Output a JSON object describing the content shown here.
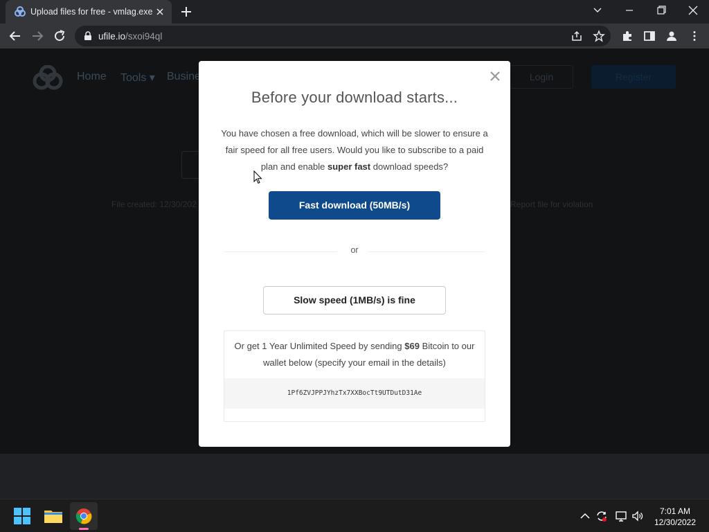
{
  "browser": {
    "tab_title": "Upload files for free - vmlag.exe",
    "url_host": "ufile.io",
    "url_path": "/sxoi94ql"
  },
  "page_bg": {
    "nav": [
      "Home",
      "Tools",
      "Busine"
    ],
    "login": "Login",
    "register": "Register",
    "file_created": "File created: 12/30/202",
    "report": "Report file for violation"
  },
  "modal": {
    "title": "Before your download starts...",
    "text_part1": "You have chosen a free download, which will be slower to ensure a fair speed for all free users. Would you like to subscribe to a paid plan and enable ",
    "text_bold": "super fast",
    "text_part2": " download speeds?",
    "fast_button": "Fast download (50MB/s)",
    "or": "or",
    "slow_button": "Slow speed (1MB/s) is fine",
    "btc_part1": "Or get 1 Year Unlimited Speed by sending ",
    "btc_price": "$69",
    "btc_part2": " Bitcoin to our wallet below (specify your email in the details)",
    "wallet": "1Pf6ZVJPPJYhzTx7XXBocTt9UTDutD31Ae"
  },
  "taskbar": {
    "time": "7:01 AM",
    "date": "12/30/2022"
  },
  "colors": {
    "accent": "#0e4a8c",
    "chrome_dark": "#202124",
    "chrome_toolbar": "#35363a"
  }
}
